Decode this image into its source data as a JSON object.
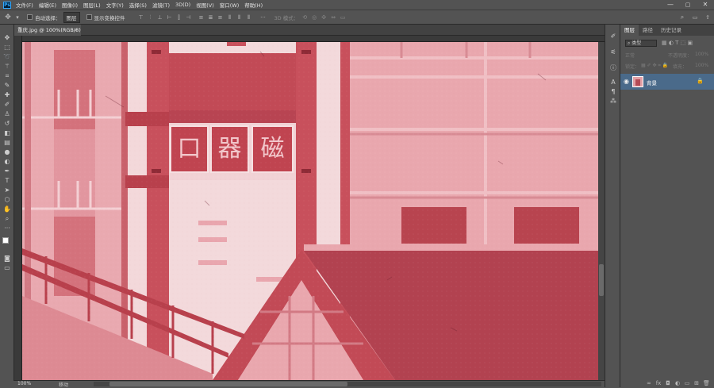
{
  "menu": {
    "items": [
      "文件(F)",
      "编辑(E)",
      "图像(I)",
      "图层(L)",
      "文字(Y)",
      "选择(S)",
      "滤镜(T)",
      "3D(D)",
      "视图(V)",
      "窗口(W)",
      "帮助(H)"
    ],
    "logo": "Ps"
  },
  "window": {
    "minimize": "—",
    "maximize": "▢",
    "close": "✕"
  },
  "options": {
    "auto_select_label": "自动选择：",
    "auto_select_value": "图层",
    "show_transform_label": "显示变换控件",
    "mode_3d_label": "3D 模式："
  },
  "document": {
    "tab_title": "重庆.jpg @ 100%(RGB/8)",
    "tab_close": "×"
  },
  "status": {
    "zoom": "100%",
    "info": "移动"
  },
  "canvas_text": {
    "chars": [
      "口",
      "器",
      "磁"
    ]
  },
  "layers_panel": {
    "tabs": [
      "图层",
      "路径",
      "历史记录"
    ],
    "filter_label": "类型",
    "blend_mode": "正常",
    "opacity_label": "不透明度：",
    "opacity_value": "100%",
    "lock_label": "锁定：",
    "fill_label": "填充：",
    "fill_value": "100%",
    "layer_name": "背景"
  },
  "colors": {
    "accent": "#4a6a8a",
    "canvas_bg": "#e7c2c5",
    "dark_red": "#b44a55"
  },
  "icons": [
    "move-icon",
    "marquee-icon",
    "lasso-icon",
    "magic-wand-icon",
    "crop-icon",
    "eyedropper-icon",
    "healing-icon",
    "brush-icon",
    "stamp-icon",
    "history-brush-icon",
    "eraser-icon",
    "gradient-icon",
    "blur-icon",
    "dodge-icon",
    "pen-icon",
    "type-icon",
    "path-select-icon",
    "shape-icon",
    "hand-icon",
    "zoom-icon",
    "more-icon"
  ]
}
